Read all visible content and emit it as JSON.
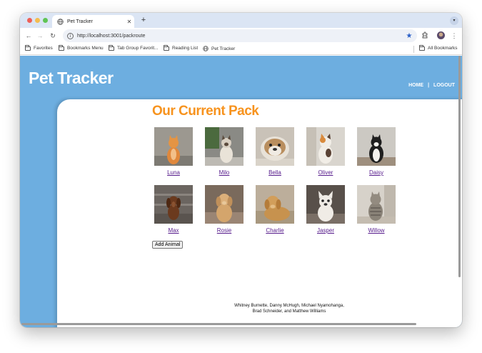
{
  "browser": {
    "tab_title": "Pet Tracker",
    "url": "http://localhost:3001/packroute",
    "bookmarks": [
      {
        "label": "Favorites"
      },
      {
        "label": "Bookmarks Menu"
      },
      {
        "label": "Tab Group Favorit..."
      },
      {
        "label": "Reading List"
      },
      {
        "label": "Pet Tracker"
      }
    ],
    "all_bookmarks": "All Bookmarks",
    "new_tab": "+",
    "close_tab": "✕"
  },
  "site": {
    "title": "Pet Tracker",
    "nav": {
      "home": "HOME",
      "separator": "|",
      "logout": "LOGOUT"
    }
  },
  "pack": {
    "heading": "Our Current Pack",
    "pets": [
      {
        "name": "Luna",
        "photo": "orange-tabby-cat"
      },
      {
        "name": "Milo",
        "photo": "siamese-cat"
      },
      {
        "name": "Bella",
        "photo": "english-bulldog"
      },
      {
        "name": "Oliver",
        "photo": "calico-cat"
      },
      {
        "name": "Daisy",
        "photo": "tuxedo-cat"
      },
      {
        "name": "Max",
        "photo": "dachshund"
      },
      {
        "name": "Rosie",
        "photo": "golden-retriever"
      },
      {
        "name": "Charlie",
        "photo": "golden-retriever-lying"
      },
      {
        "name": "Jasper",
        "photo": "french-bulldog"
      },
      {
        "name": "Willow",
        "photo": "tabby-cat"
      }
    ],
    "add_button": "Add Animal"
  },
  "footer": {
    "line1": "Whitney Burnette, Danny McHugh, Michael Nyamohanga,",
    "line2": "Brad Schneider, and Matthew Williams"
  },
  "colors": {
    "header_bg": "#6daee0",
    "heading": "#f7931e",
    "link": "#551a8b"
  }
}
